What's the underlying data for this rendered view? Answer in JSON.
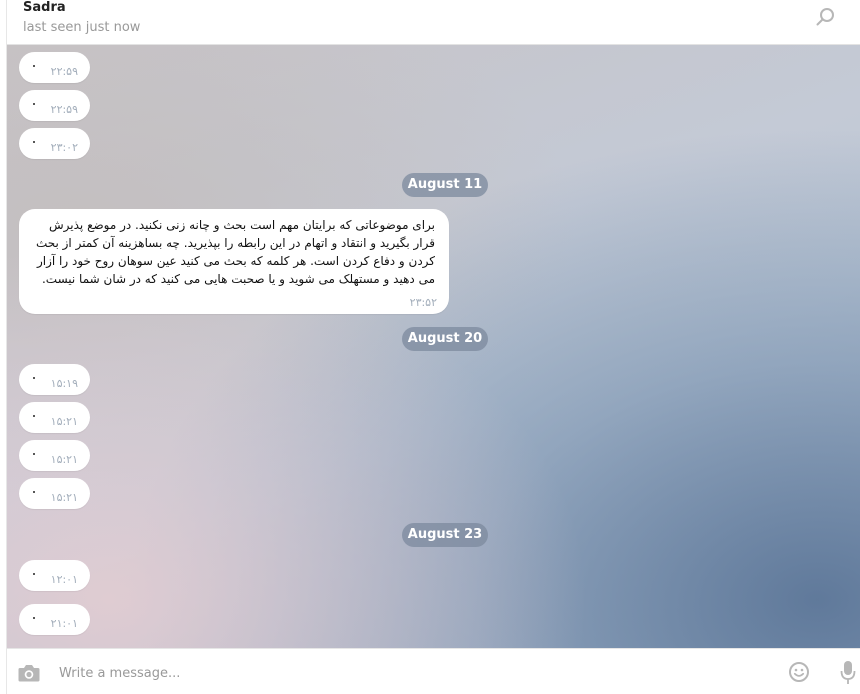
{
  "header": {
    "peer_name": "Sadra",
    "status": "last seen just now",
    "search_icon": "search-icon"
  },
  "messages": {
    "m1": {
      "text": "·",
      "time": "۲۲:۵۹"
    },
    "m2": {
      "text": "·",
      "time": "۲۲:۵۹"
    },
    "m3": {
      "text": "·",
      "time": "۲۳:۰۲"
    },
    "d1": "August 11",
    "m4": {
      "text": "برای موضوعاتی که برایتان مهم است بحث و چانه زنی نکنید. در موضع پذیرش قرار بگیرید و انتقاد و اتهام در این رابطه را بپذیرید. چه بساهزینه آن کمتر از بحث کردن و دفاع کردن است. هر کلمه که بحث می کنید عین سوهان روح خود را آزار می دهید و مستهلک می شوید و یا صحبت هایی می کنید که در شان شما نیست.",
      "time": "۲۳:۵۲"
    },
    "d2": "August 20",
    "m5": {
      "text": "·",
      "time": "۱۵:۱۹"
    },
    "m6": {
      "text": "·",
      "time": "۱۵:۲۱"
    },
    "m7": {
      "text": "·",
      "time": "۱۵:۲۱"
    },
    "m8": {
      "text": "·",
      "time": "۱۵:۲۱"
    },
    "d3": "August 23",
    "m9": {
      "text": "·",
      "time": "۱۲:۰۱"
    },
    "m10": {
      "text": "·",
      "time": "۲۱:۰۱"
    }
  },
  "composer": {
    "placeholder": "Write a message...",
    "attach_icon": "camera-icon",
    "emoji_icon": "smile-icon",
    "mic_icon": "microphone-icon"
  },
  "colors": {
    "bubble": "#ffffff",
    "date_chip": "#7c8a9e",
    "time_text": "#a3aebb",
    "icon_gray": "#b7b7b7"
  }
}
